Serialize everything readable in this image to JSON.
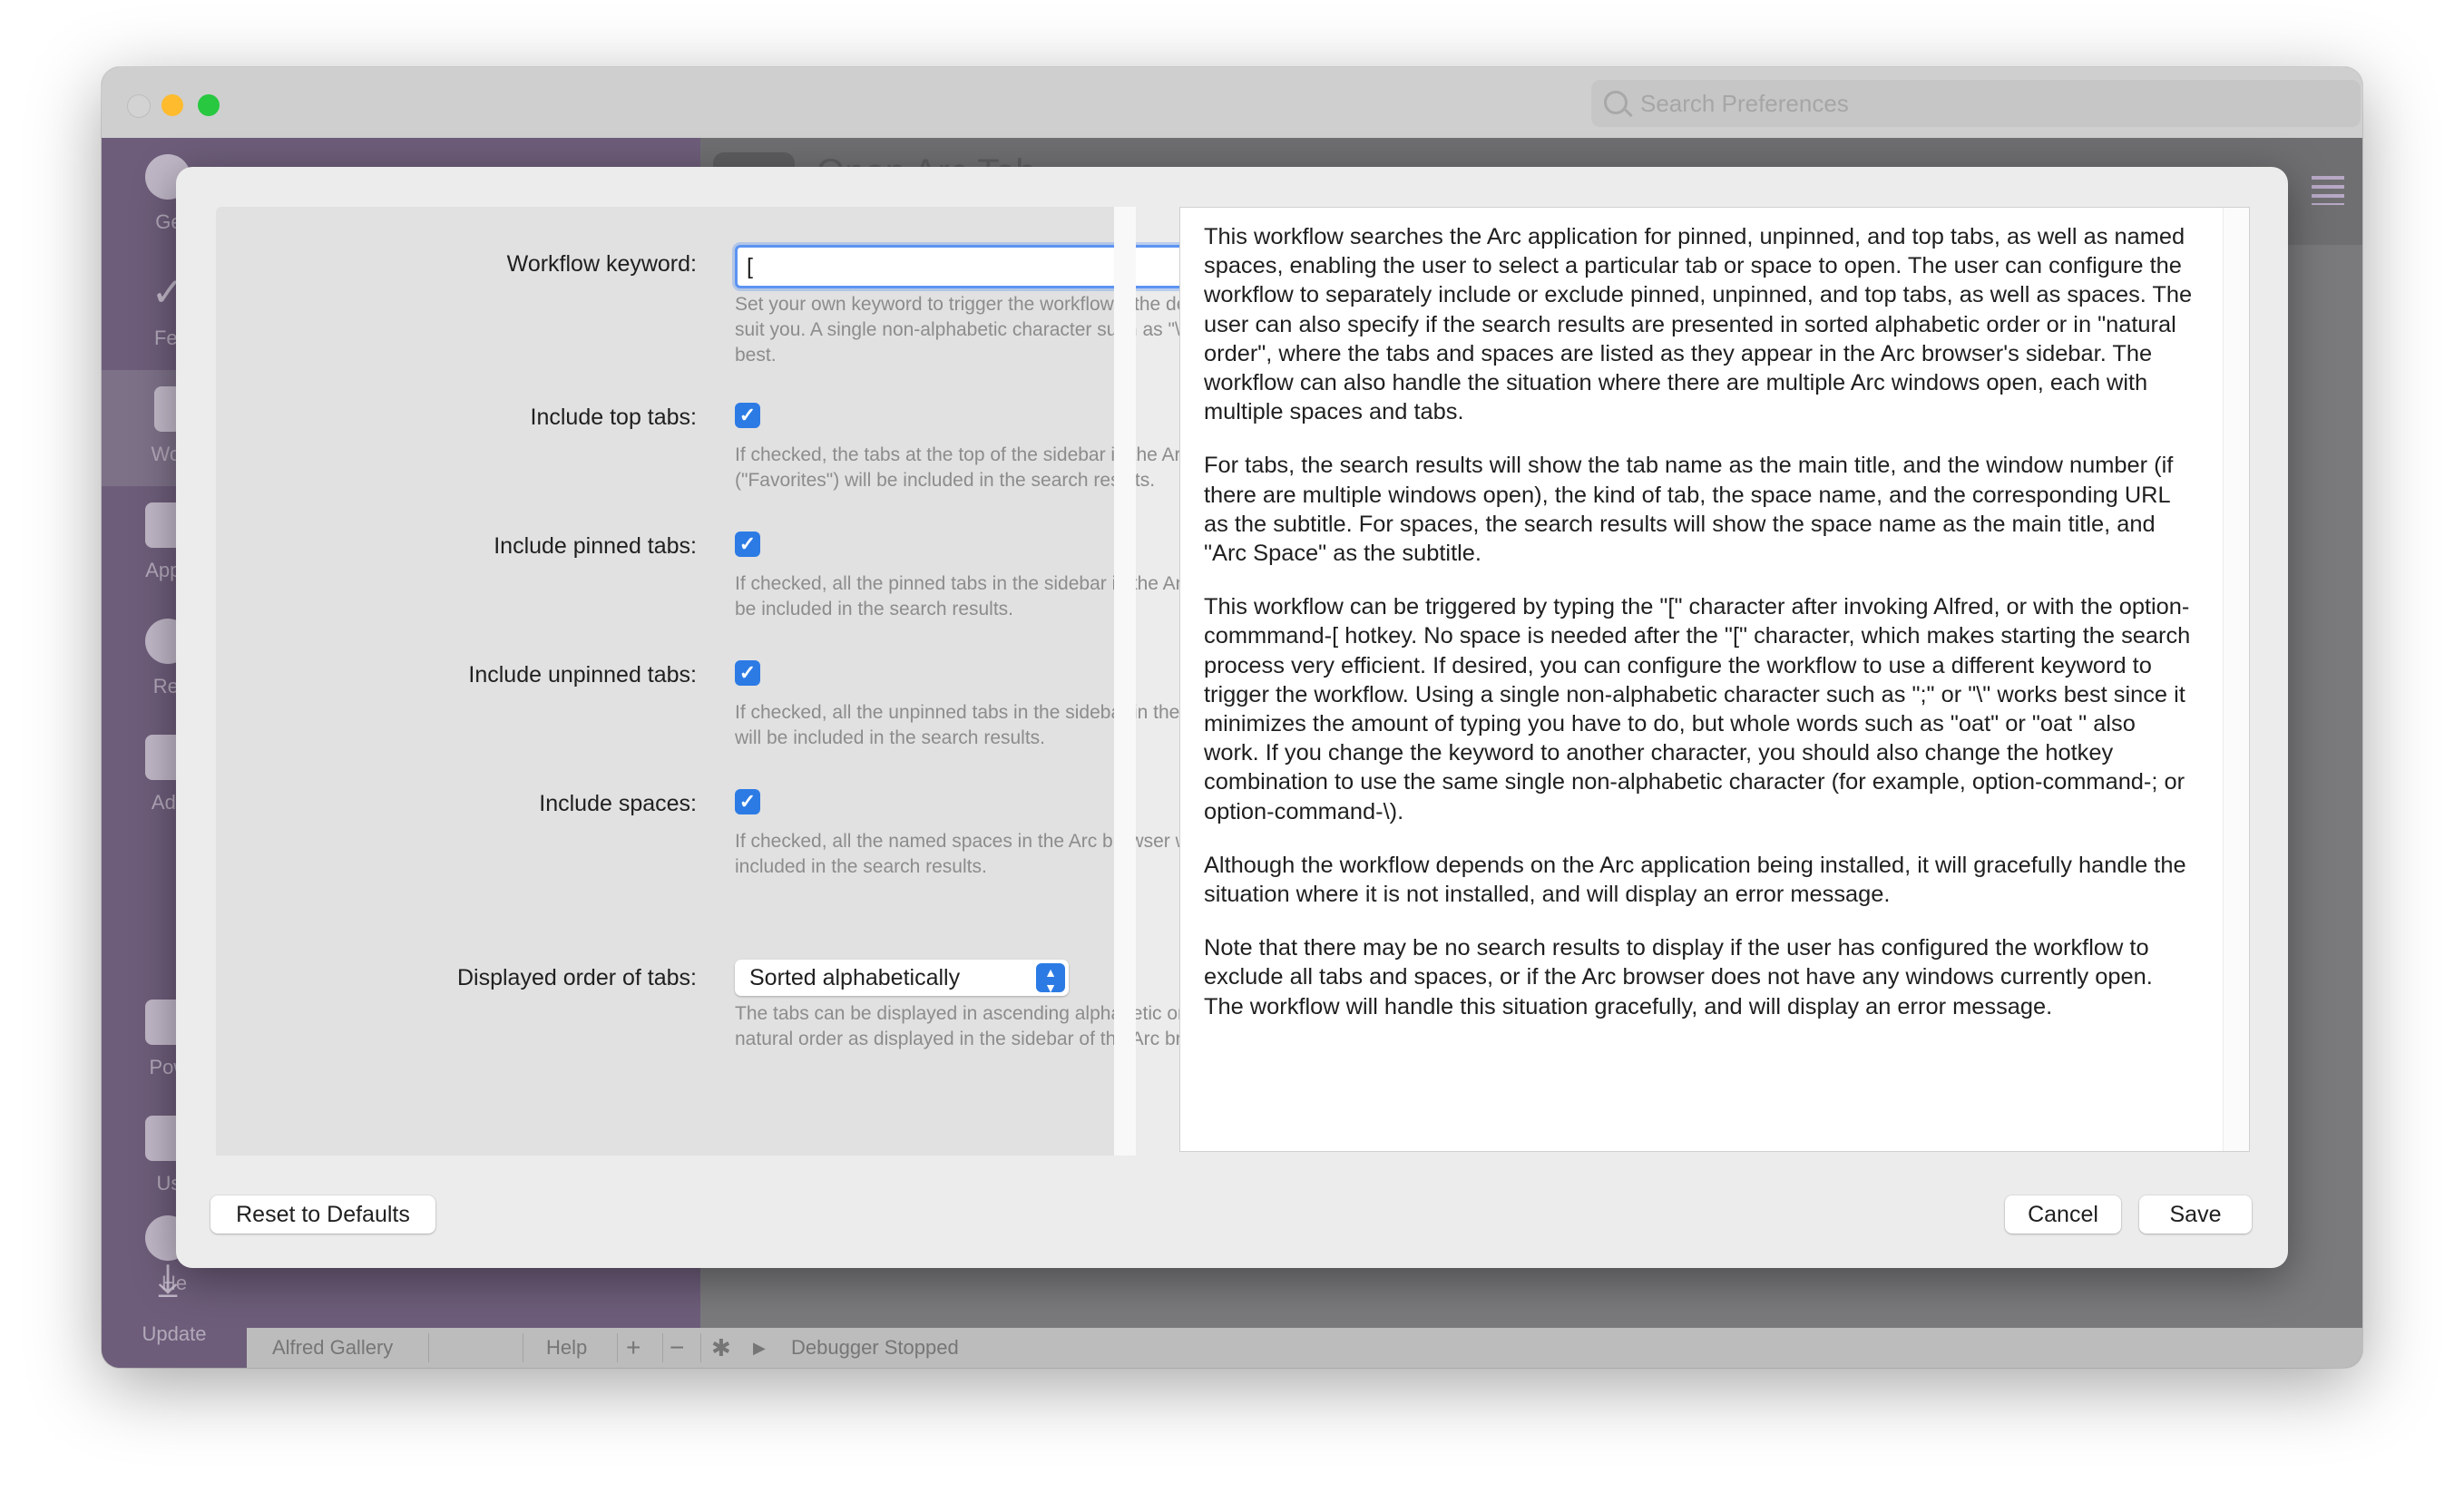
{
  "window": {
    "search_placeholder": "Search Preferences",
    "background_title": "Open Arc Tab"
  },
  "sidebar": {
    "items": [
      {
        "label": "Gen",
        "icon": "cloud-icon"
      },
      {
        "label": "Feat",
        "icon": "check-icon"
      },
      {
        "label": "Work",
        "icon": "workflows-icon"
      },
      {
        "label": "Appea",
        "icon": "appearance-icon"
      },
      {
        "label": "Rem",
        "icon": "remote-icon"
      },
      {
        "label": "Adva",
        "icon": "advanced-icon"
      },
      {
        "label": "Powe",
        "icon": "powerpack-icon"
      },
      {
        "label": "Usa",
        "icon": "usage-icon"
      },
      {
        "label": "He",
        "icon": "help-icon"
      },
      {
        "label": "Update",
        "icon": "download-icon"
      }
    ]
  },
  "bottombar": {
    "gallery": "Alfred Gallery",
    "help": "Help",
    "add": "+",
    "remove": "−",
    "debugger_status": "Debugger Stopped"
  },
  "form": {
    "keyword_label": "Workflow keyword:",
    "keyword_value": "[",
    "keyword_help": "Set your own keyword to trigger the workflow if the default doesn't suit you. A single non-alphabetic character such as \"\\\" or \";\" works best.",
    "top_tabs_label": "Include top tabs:",
    "top_tabs_checked": true,
    "top_tabs_help": "If checked, the tabs at the top of the sidebar in the Arc browser (\"Favorites\") will be included in the search results.",
    "pinned_tabs_label": "Include pinned tabs:",
    "pinned_tabs_checked": true,
    "pinned_tabs_help": "If checked, all the pinned tabs in the sidebar in the Arc browser will be included in the search results.",
    "unpinned_tabs_label": "Include unpinned tabs:",
    "unpinned_tabs_checked": true,
    "unpinned_tabs_help": "If checked, all the unpinned tabs in the sidebar in the Arc browser will be included in the search results.",
    "spaces_label": "Include spaces:",
    "spaces_checked": true,
    "spaces_help": "If checked, all the named spaces in the Arc browser will be included in the search results.",
    "order_label": "Displayed order of tabs:",
    "order_value": "Sorted alphabetically",
    "order_help": "The tabs can be displayed in ascending alphabetic order or in their natural order as displayed in the sidebar of the Arc browser."
  },
  "description": {
    "paragraphs": [
      "This workflow searches the Arc application for pinned, unpinned, and top tabs, as well as named spaces, enabling the user to select a particular tab or space to open. The user can configure the workflow to separately include or exclude pinned, unpinned, and top tabs, as well as spaces. The user can also specify if the search results are presented in sorted alphabetic order or in \"natural order\", where the tabs and spaces are listed as they appear in the Arc browser's sidebar. The workflow can also handle the situation where there are multiple Arc windows open, each with multiple spaces and tabs.",
      "For tabs, the search results will show the tab name as the main title, and the window number (if there are multiple windows open), the kind of tab, the space name, and the corresponding URL as the subtitle. For spaces, the search results will show the space name as the main title, and \"Arc Space\" as the subtitle.",
      "This workflow can be triggered by typing the \"[\" character after invoking Alfred, or with the option-commmand-[ hotkey. No space is needed after the \"[\" character, which makes starting the search process very efficient. If desired, you can configure the workflow to use a different keyword to trigger the workflow. Using a single non-alphabetic character such as \";\" or \"\\\" works best since it minimizes the amount of typing you have to do, but whole words such as \"oat\" or \"oat \" also work. If you change the keyword to another character, you should also change the hotkey combination to use the same single non-alphabetic character (for example, option-command-; or option-command-\\).",
      "Although the workflow depends on the Arc application being installed, it will gracefully handle the situation where it is not installed, and will display an error message.",
      "Note that there may be no search results to display if the user has configured the workflow to exclude all tabs and spaces, or if the Arc browser does not have any windows currently open. The workflow will handle this situation gracefully, and will display an error message."
    ]
  },
  "buttons": {
    "reset": "Reset to Defaults",
    "cancel": "Cancel",
    "save": "Save"
  },
  "colors": {
    "accent": "#2c7be5",
    "sidebar": "#6d5d7a",
    "focus_ring": "#5d94f2"
  }
}
